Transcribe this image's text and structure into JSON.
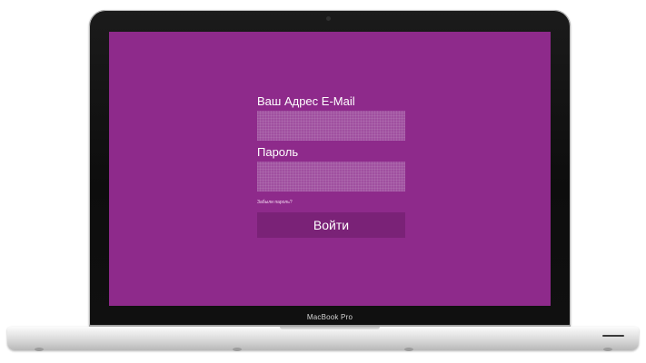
{
  "device": {
    "model_label": "MacBook Pro"
  },
  "login_form": {
    "email": {
      "label": "Ваш Адрес E-Mail",
      "value": "",
      "placeholder": ""
    },
    "password": {
      "label": "Пароль",
      "value": "",
      "placeholder": ""
    },
    "forgot_password_link": "Забыли пароль?",
    "submit_button": "Войти"
  },
  "colors": {
    "screen_background": "#8e2a8b",
    "input_background": "#a050a0",
    "button_background": "#7a2277",
    "text": "#ffffff"
  },
  "icons": {
    "camera": "camera-icon"
  }
}
